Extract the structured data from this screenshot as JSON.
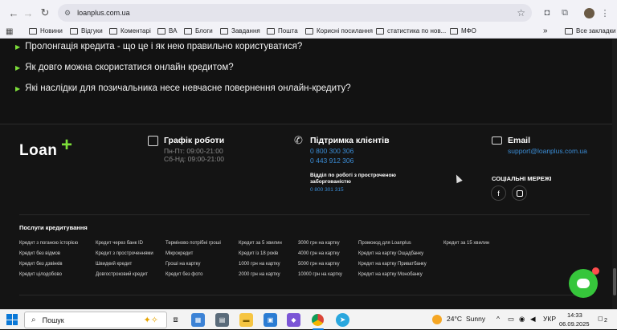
{
  "browser": {
    "url": "loanplus.com.ua",
    "nav_icons": [
      "back-icon",
      "forward-icon",
      "reload-icon"
    ],
    "right_icons": [
      "camera-icon",
      "extensions-icon",
      "profile-avatar",
      "menu-icon"
    ]
  },
  "bookmarks": {
    "items": [
      {
        "label": "Новини"
      },
      {
        "label": "Відгуки"
      },
      {
        "label": "Коментарі"
      },
      {
        "label": "ВА"
      },
      {
        "label": "Блоги"
      },
      {
        "label": "Завдання"
      },
      {
        "label": "Пошта"
      },
      {
        "label": "Корисні посилання"
      },
      {
        "label": "статистика по нов..."
      },
      {
        "label": "МФО"
      }
    ],
    "more": "»",
    "all_label": "Все закладки"
  },
  "faq": [
    "Пролонгація кредита - що це і як нею правильно користуватися?",
    "Як довго можна скористатися онлайн кредитом?",
    "Які наслідки для позичальника несе невчасне повернення онлайн-кредиту?"
  ],
  "footer": {
    "logo": "Loan",
    "logo_plus": "+",
    "schedule": {
      "title": "Графік роботи",
      "weekdays": "Пн-Пт: 09:00-21:00",
      "weekend": "Сб-Нд: 09:00-21:00"
    },
    "support": {
      "title": "Підтримка клієнтів",
      "phone1": "0 800 300 306",
      "phone2": "0 443 912 306",
      "overdue_title": "Відділ по роботі з простроченою заборгованістю",
      "overdue_phone": "0 800 301 315"
    },
    "email": {
      "title": "Email",
      "address": "support@loanplus.com.ua"
    },
    "social": {
      "title": "СОЦІАЛЬНІ МЕРЕЖІ",
      "icons": [
        "facebook-icon",
        "instagram-icon"
      ]
    },
    "services_title": "Послуги кредитування",
    "services": [
      [
        "Кредит з поганою історією",
        "Кредит без відмов",
        "Кредит без дзвінків",
        "Кредит цілодобово"
      ],
      [
        "Кредит через банк ID",
        "Кредит з простроченнями",
        "Швидкий кредит",
        "Довгостроковий кредит"
      ],
      [
        "Терміново потрібні гроші",
        "Мікрокредит",
        "Гроші на картку",
        "Кредит без фото"
      ],
      [
        "Кредит за 5 хвилин",
        "Кредит із 18 років",
        "1000 грн на картку",
        "2000 грн на картку"
      ],
      [
        "3000 грн на картку",
        "4000 грн на картку",
        "5000 грн на картку",
        "10000 грн на картку"
      ],
      [
        "Промокод для Loanplus",
        "Кредит на картку Ощадбанку",
        "Кредит на картку Приватбанку",
        "Кредит на картку Монобанку"
      ],
      [
        "Кредит за 15 хвилин"
      ]
    ]
  },
  "taskbar": {
    "search_placeholder": "Пошук",
    "weather_temp": "24°C",
    "weather_text": "Sunny",
    "language": "УКР",
    "time": "14:33",
    "date": "06.09.2025",
    "notification_count": "2"
  }
}
